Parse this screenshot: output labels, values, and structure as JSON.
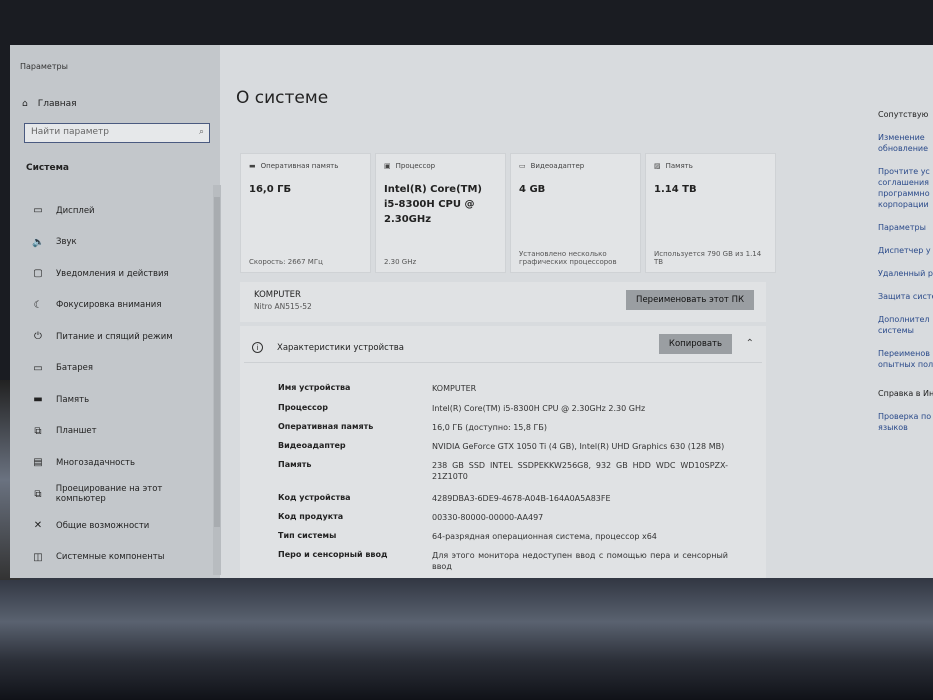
{
  "window": {
    "title": "Параметры"
  },
  "sidebar": {
    "home": "Главная",
    "search_placeholder": "Найти параметр",
    "section": "Система",
    "items": [
      {
        "label": "Дисплей",
        "icon": "monitor-icon",
        "glyph": "▭"
      },
      {
        "label": "Звук",
        "icon": "speaker-icon",
        "glyph": "🔈"
      },
      {
        "label": "Уведомления и действия",
        "icon": "notification-icon",
        "glyph": "▢"
      },
      {
        "label": "Фокусировка внимания",
        "icon": "moon-icon",
        "glyph": "☾"
      },
      {
        "label": "Питание и спящий режим",
        "icon": "power-icon",
        "glyph": "⏻"
      },
      {
        "label": "Батарея",
        "icon": "battery-icon",
        "glyph": "▭"
      },
      {
        "label": "Память",
        "icon": "storage-icon",
        "glyph": "▬"
      },
      {
        "label": "Планшет",
        "icon": "tablet-icon",
        "glyph": "⧉"
      },
      {
        "label": "Многозадачность",
        "icon": "multitask-icon",
        "glyph": "▤"
      },
      {
        "label": "Проецирование на этот компьютер",
        "icon": "project-icon",
        "glyph": "⧉"
      },
      {
        "label": "Общие возможности",
        "icon": "shared-icon",
        "glyph": "✕"
      },
      {
        "label": "Системные компоненты",
        "icon": "components-icon",
        "glyph": "◫"
      }
    ]
  },
  "main": {
    "title": "О системе",
    "cards": [
      {
        "label": "Оперативная память",
        "value": "16,0 ГБ",
        "sub": "Скорость: 2667 МГц",
        "icon": "ram-icon",
        "glyph": "▬"
      },
      {
        "label": "Процессор",
        "value": "Intel(R) Core(TM) i5-8300H CPU @ 2.30GHz",
        "sub": "2.30 GHz",
        "icon": "cpu-icon",
        "glyph": "▣"
      },
      {
        "label": "Видеоадаптер",
        "value": "4 GB",
        "sub": "Установлено несколько графических процессоров",
        "icon": "gpu-icon",
        "glyph": "▭"
      },
      {
        "label": "Память",
        "value": "1.14 TB",
        "sub": "Используется 790 GB из 1.14 TB",
        "icon": "disk-icon",
        "glyph": "▨"
      }
    ],
    "pc_name": "KOMPUTER",
    "pc_model": "Nitro AN515-52",
    "rename_button": "Переименовать этот ПК",
    "specs": {
      "title": "Характеристики устройства",
      "copy_button": "Копировать",
      "rows": [
        {
          "k": "Имя устройства",
          "v": "KOMPUTER"
        },
        {
          "k": "Процессор",
          "v": "Intel(R) Core(TM) i5-8300H CPU @ 2.30GHz   2.30 GHz"
        },
        {
          "k": "Оперативная память",
          "v": "16,0 ГБ (доступно: 15,8 ГБ)"
        },
        {
          "k": "Видеоадаптер",
          "v": "NVIDIA GeForce GTX 1050 Ti (4 GB), Intel(R) UHD Graphics 630 (128 MB)"
        },
        {
          "k": "Память",
          "v": "238 GB SSD INTEL SSDPEKKW256G8, 932 GB HDD WDC WD10SPZX-21Z10T0"
        },
        {
          "k": "Код устройства",
          "v": "4289DBA3-6DE9-4678-A04B-164A0A5A83FE"
        },
        {
          "k": "Код продукта",
          "v": "00330-80000-00000-AA497"
        },
        {
          "k": "Тип системы",
          "v": "64-разрядная операционная система, процессор x64"
        },
        {
          "k": "Перо и сенсорный ввод",
          "v": "Для этого монитора недоступен ввод с помощью пера и сенсорный ввод"
        }
      ]
    }
  },
  "related": {
    "title": "Сопутствую",
    "links": [
      "Изменение обновление",
      "Прочтите ус соглашения программно корпорации",
      "Параметры",
      "Диспетчер у",
      "Удаленный р",
      "Защита систе",
      "Дополнител системы",
      "Переименов опытных пол"
    ],
    "help_title": "Справка в Ин",
    "help_links": [
      "Проверка по языков"
    ]
  }
}
